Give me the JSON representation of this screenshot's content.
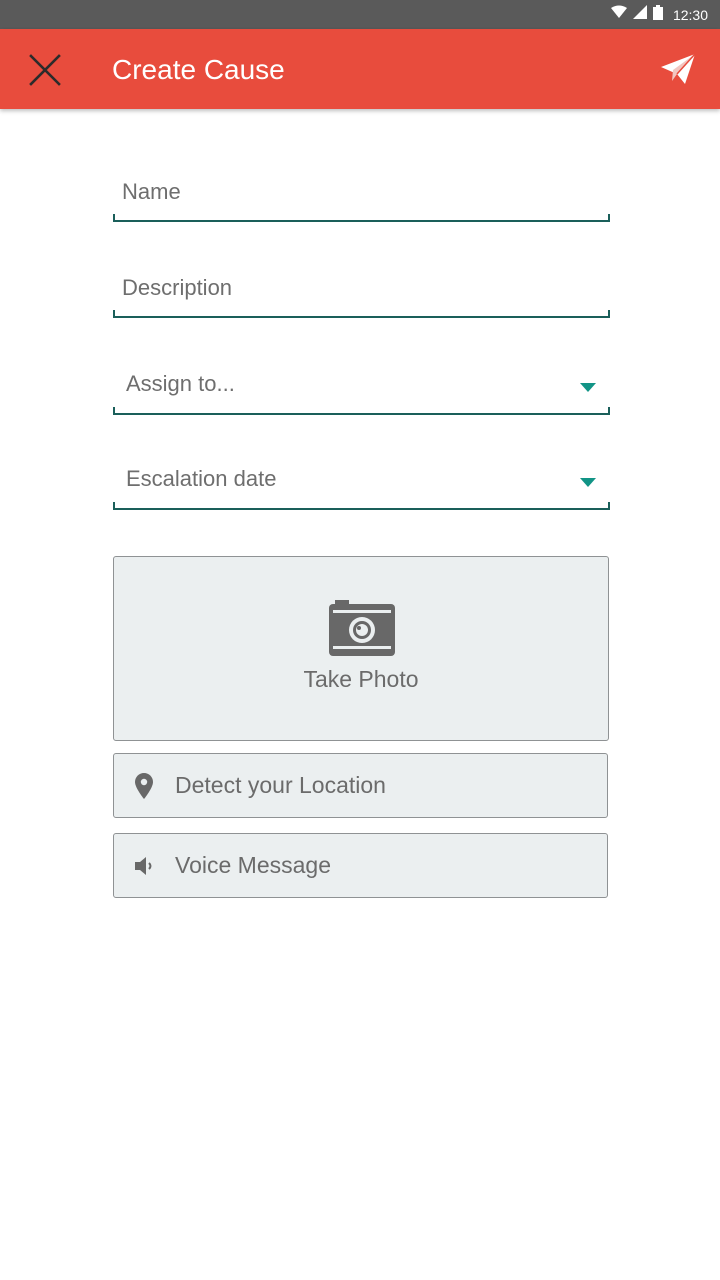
{
  "status_bar": {
    "time": "12:30"
  },
  "app_bar": {
    "title": "Create Cause",
    "background": "#e84c3d"
  },
  "form": {
    "name": {
      "placeholder": "Name",
      "value": ""
    },
    "description": {
      "placeholder": "Description",
      "value": ""
    },
    "assign_to": {
      "label": "Assign to..."
    },
    "escalation_date": {
      "label": "Escalation date"
    }
  },
  "photo": {
    "label": "Take Photo",
    "icon": "camera-icon"
  },
  "location": {
    "label": "Detect your Location",
    "icon": "location-pin-icon"
  },
  "voice": {
    "label": "Voice Message",
    "icon": "speaker-icon"
  },
  "colors": {
    "accent": "#129486",
    "underline": "#1a5f5a",
    "button_bg": "#ebeff0"
  }
}
